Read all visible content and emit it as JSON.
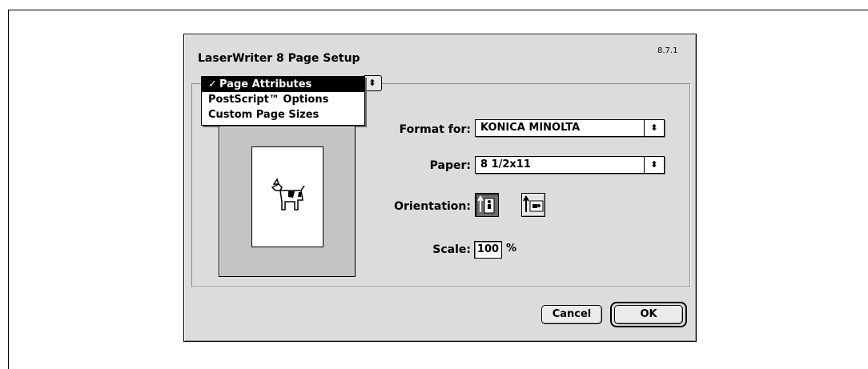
{
  "dialog": {
    "title": "LaserWriter 8 Page Setup",
    "version": "8.7.1"
  },
  "panel_menu": {
    "items": [
      {
        "label": "Page Attributes",
        "checked": true
      },
      {
        "label": "PostScript™ Options",
        "checked": false
      },
      {
        "label": "Custom Page Sizes",
        "checked": false
      }
    ],
    "check_mark": "✓"
  },
  "format_for": {
    "label": "Format for:",
    "value": "KONICA MINOLTA"
  },
  "paper": {
    "label": "Paper:",
    "value": "8 1/2x11"
  },
  "orientation": {
    "label": "Orientation:",
    "selected": "portrait"
  },
  "scale": {
    "label": "Scale:",
    "value": "100",
    "unit": "%"
  },
  "buttons": {
    "cancel": "Cancel",
    "ok": "OK"
  },
  "icons": {
    "preview": "dogcow-icon",
    "portrait": "portrait-orientation-icon",
    "landscape": "landscape-orientation-icon",
    "popup_arrows": "up-down-arrows-icon"
  }
}
